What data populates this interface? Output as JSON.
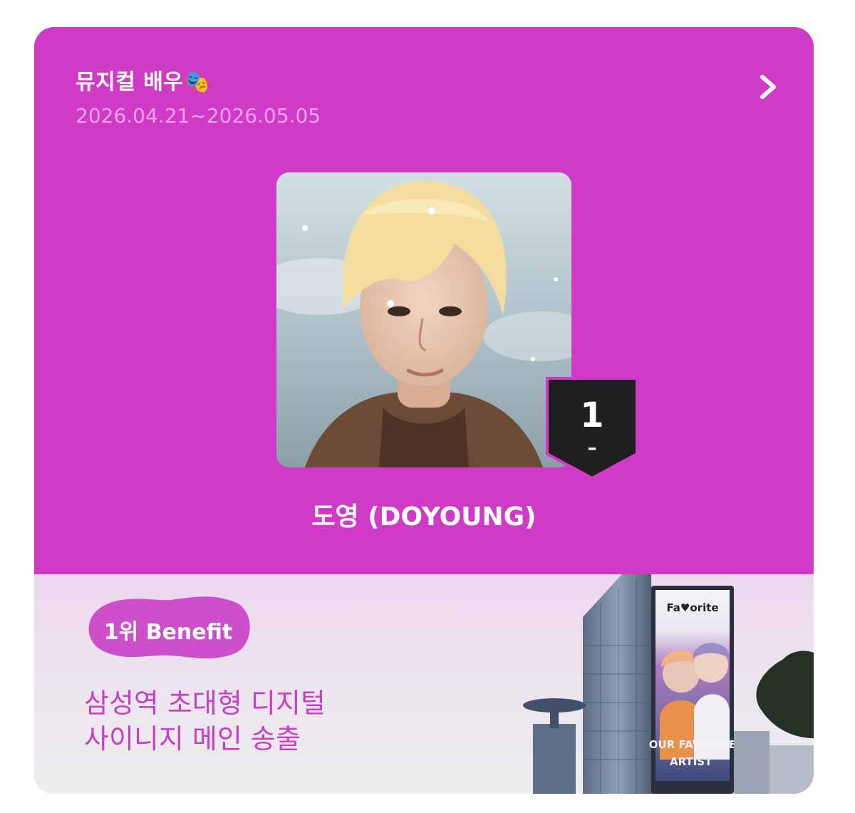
{
  "ranking": {
    "title": "뮤지컬 배우🎭",
    "period": "2026.04.21~2026.05.05",
    "more_icon": "chevron-right-icon",
    "winner": {
      "rank": "1",
      "rank_change": "–",
      "name": "도영 (DOYOUNG)"
    }
  },
  "benefit": {
    "label": "1위 Benefit",
    "line1": "삼성역 초대형 디지털",
    "line2": "사이니지 메인 송출",
    "billboard_logo": "Fa♥orite",
    "billboard_line1": "OUR FAVORITE",
    "billboard_line2": "ARTIST"
  },
  "colors": {
    "card_bg": "#cf3ac7",
    "period_text": "#f0a3ec",
    "badge_bg": "#1f1f1f",
    "benefit_text": "#c640c4"
  }
}
